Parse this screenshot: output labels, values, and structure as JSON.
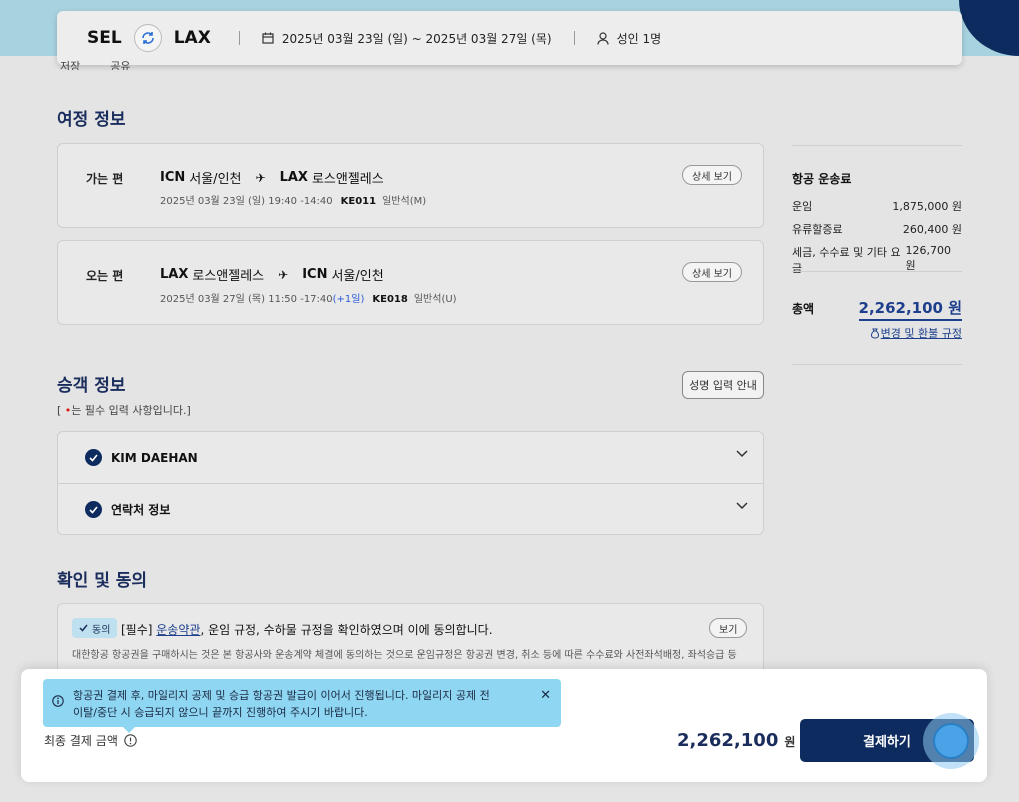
{
  "search": {
    "from": "SEL",
    "to": "LAX",
    "dates": "2025년 03월 23일 (일) ~ 2025년 03월 27일 (목)",
    "passengers": "성인 1명"
  },
  "sub_actions": {
    "save": "저장",
    "share": "공유"
  },
  "itinerary": {
    "title": "여정 정보",
    "segments": [
      {
        "label": "가는 편",
        "from_code": "ICN",
        "from_city": "서울/인천",
        "to_code": "LAX",
        "to_city": "로스앤젤레스",
        "date_time": "2025년 03월 23일 (일) 19:40 -14:40",
        "plus_day": "",
        "flight_no": "KE011",
        "cabin": "일반석(M)",
        "detail_btn": "상세 보기"
      },
      {
        "label": "오는 편",
        "from_code": "LAX",
        "from_city": "로스앤젤레스",
        "to_code": "ICN",
        "to_city": "서울/인천",
        "date_time": "2025년 03월 27일 (목) 11:50 -17:40",
        "plus_day": "(+1일)",
        "flight_no": "KE018",
        "cabin": "일반석(U)",
        "detail_btn": "상세 보기"
      }
    ]
  },
  "fare": {
    "title": "항공 운송료",
    "rows": [
      {
        "label": "운임",
        "value": "1,875,000 원"
      },
      {
        "label": "유류할증료",
        "value": "260,400 원"
      },
      {
        "label": "세금, 수수료 및 기타 요금",
        "value": "126,700 원"
      }
    ],
    "total_label": "총액",
    "total_value": "2,262,100 원",
    "refund_link": "변경 및 환불 규정"
  },
  "passenger": {
    "title": "승객 정보",
    "name_guide_btn": "성명 입력 안내",
    "required_note_pre": "[ ",
    "required_note_dot": "•",
    "required_note_post": "는 필수 입력 사항입니다.]",
    "rows": [
      {
        "label": "KIM DAEHAN"
      },
      {
        "label": "연락처 정보"
      }
    ]
  },
  "consent": {
    "title": "확인 및 동의",
    "badge": "동의",
    "text_pre": "[필수] ",
    "text_link": "운송약관",
    "text_post": ", 운임 규정, 수하물 규정을 확인하였으며 이에 동의합니다.",
    "view_btn": "보기",
    "desc": "대한항공 항공권을 구매하시는 것은 본 항공사와 운송계약 체결에 동의하는 것으로 운임규정은 항공권 변경, 취소 등에 따른 수수료와 사전좌석배정, 좌석승급 등"
  },
  "bottom": {
    "tooltip_line1": "항공권 결제 후, 마일리지 공제 및 승급 항공권 발급이 이어서 진행됩니다. 마일리지 공제 전",
    "tooltip_line2": "이탈/중단 시 승급되지 않으니 끝까지 진행하여 주시기 바랍니다.",
    "final_label": "최종 결제 금액",
    "final_amount": "2,262,100",
    "final_unit": "원",
    "pay_btn": "결제하기"
  },
  "colors": {
    "navy": "#0d2b5e",
    "accent_blue": "#1d3f8c",
    "tooltip_bg": "#8fd6f2"
  }
}
